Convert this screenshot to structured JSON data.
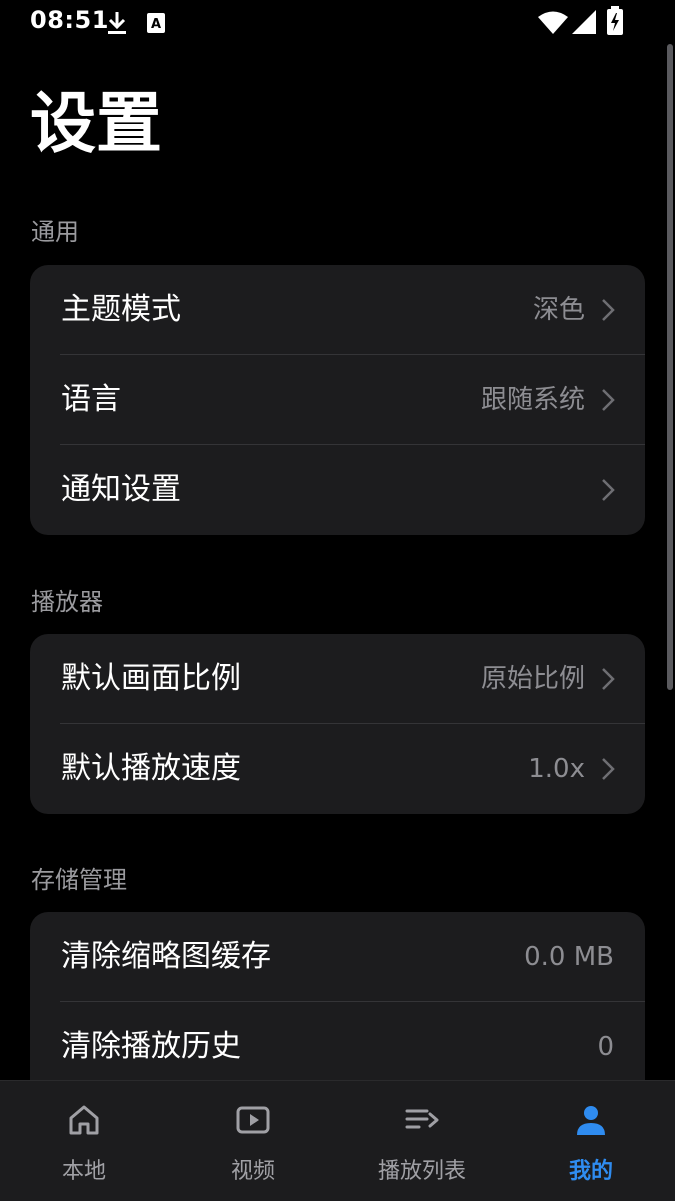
{
  "status_bar": {
    "time": "08:51",
    "icons": [
      "download-icon",
      "a-notification-icon",
      "wifi-icon",
      "signal-icon",
      "battery-charging-icon"
    ]
  },
  "page": {
    "title": "设置"
  },
  "sections": {
    "general": {
      "header": "通用",
      "items": [
        {
          "label": "主题模式",
          "value": "深色"
        },
        {
          "label": "语言",
          "value": "跟随系统"
        },
        {
          "label": "通知设置",
          "value": ""
        }
      ]
    },
    "player": {
      "header": "播放器",
      "items": [
        {
          "label": "默认画面比例",
          "value": "原始比例"
        },
        {
          "label": "默认播放速度",
          "value": "1.0x"
        }
      ]
    },
    "storage": {
      "header": "存储管理",
      "items": [
        {
          "label": "清除缩略图缓存",
          "value": "0.0 MB"
        },
        {
          "label": "清除播放历史",
          "value": "0"
        }
      ]
    }
  },
  "bottom_nav": {
    "items": [
      {
        "label": "本地",
        "icon": "home-icon",
        "active": false
      },
      {
        "label": "视频",
        "icon": "video-icon",
        "active": false
      },
      {
        "label": "播放列表",
        "icon": "playlist-icon",
        "active": false
      },
      {
        "label": "我的",
        "icon": "profile-icon",
        "active": true
      }
    ]
  },
  "colors": {
    "background": "#000000",
    "card": "#1c1c1e",
    "accent": "#2f8cf0",
    "secondary_text": "#8d8d92"
  }
}
